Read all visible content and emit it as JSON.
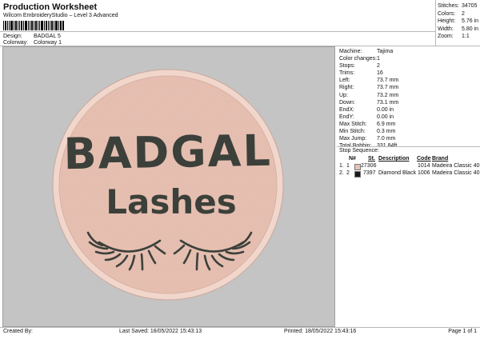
{
  "header": {
    "title": "Production Worksheet",
    "subtitle": "Wilcom EmbroideryStudio – Level 3 Advanced"
  },
  "meta": {
    "design_label": "Design:",
    "design_value": "BADGAL 5",
    "colorway_label": "Colorway:",
    "colorway_value": "Colorway 1"
  },
  "summary": [
    {
      "label": "Stitches:",
      "value": "34705"
    },
    {
      "label": "Colors:",
      "value": "2"
    },
    {
      "label": "Height:",
      "value": "5.76 in"
    },
    {
      "label": "Width:",
      "value": "5.80 in"
    },
    {
      "label": "Zoom:",
      "value": "1:1"
    }
  ],
  "design": {
    "line1": "BADGAL",
    "line2": "Lashes",
    "fill_color": "#e8c2b4",
    "border_color": "#f1d6cc",
    "thread_color": "#3c403a"
  },
  "machine_info": [
    {
      "label": "Machine:",
      "value": "Tajima"
    },
    {
      "label": "Color changes:",
      "value": "1"
    },
    {
      "label": "Stops:",
      "value": "2"
    },
    {
      "label": "Trims:",
      "value": "16"
    },
    {
      "label": "Left:",
      "value": "73.7 mm"
    },
    {
      "label": "Right:",
      "value": "73.7 mm"
    },
    {
      "label": "Up:",
      "value": "73.2 mm"
    },
    {
      "label": "Down:",
      "value": "73.1 mm"
    },
    {
      "label": "EndX:",
      "value": "0.00 in"
    },
    {
      "label": "EndY:",
      "value": "0.00 in"
    },
    {
      "label": "Max Stitch:",
      "value": "6.9 mm"
    },
    {
      "label": "Min Stitch:",
      "value": "0.3 mm"
    },
    {
      "label": "Max Jump:",
      "value": "7.0 mm"
    },
    {
      "label": "Total Bobbin:",
      "value": "331.84ft"
    }
  ],
  "stop_sequence": {
    "title": "Stop Sequence:",
    "headers": {
      "n": "N#",
      "st": "St.",
      "description": "Description",
      "code": "Code",
      "brand": "Brand"
    },
    "rows": [
      {
        "index": "1.",
        "n": "1",
        "color": "#e8c2b4",
        "st": "27306",
        "description": "",
        "code": "1014",
        "brand": "Madeira Classic 40"
      },
      {
        "index": "2.",
        "n": "2",
        "color": "#1a1a1a",
        "st": "7397",
        "description": "Diamond Black",
        "code": "1006",
        "brand": "Madeira Classic 40"
      }
    ]
  },
  "footer": {
    "created_by": "Created By:",
    "last_saved": "Last Saved: 18/05/2022 15:43:13",
    "printed": "Printed: 18/05/2022 15:43:16",
    "page": "Page 1 of 1"
  }
}
